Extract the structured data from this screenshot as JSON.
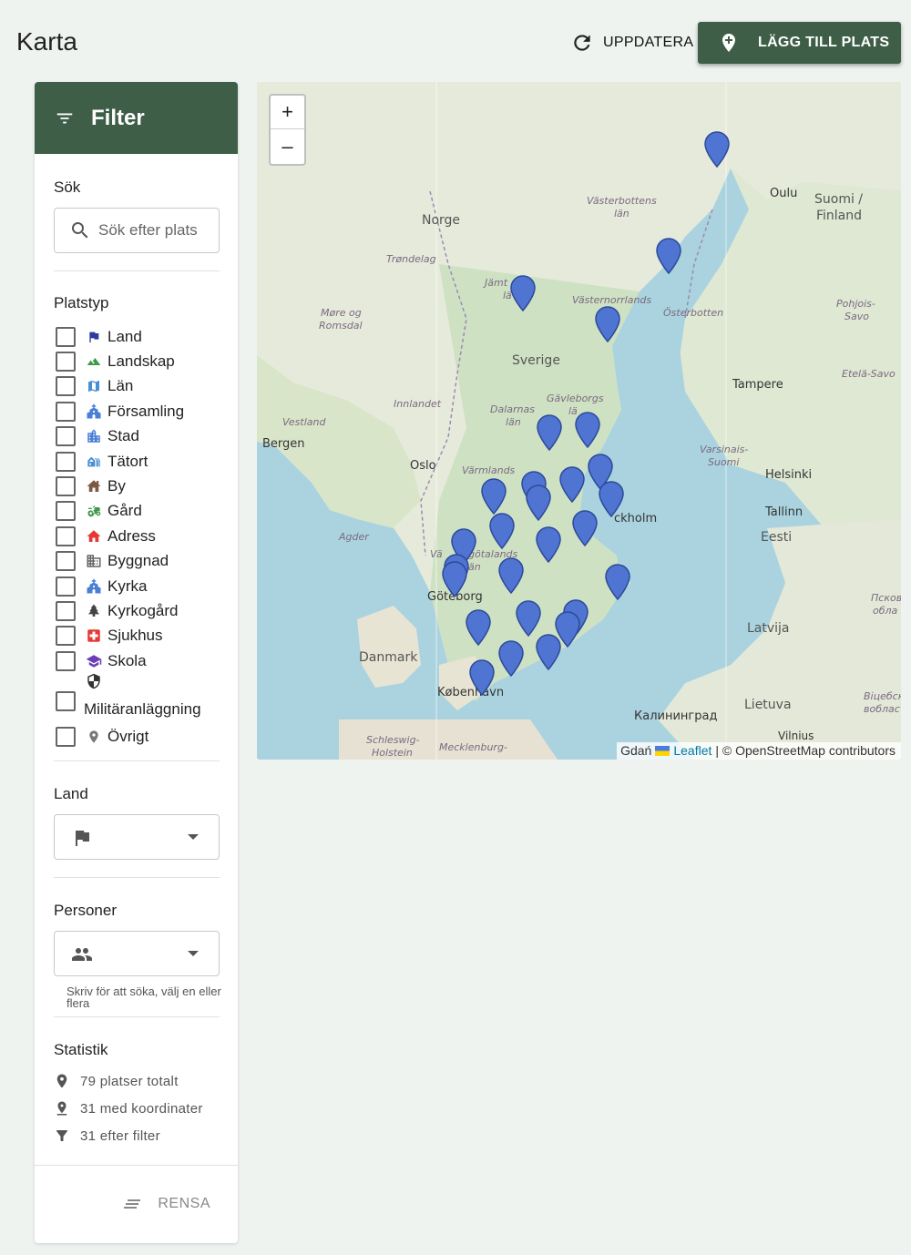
{
  "header": {
    "title": "Karta",
    "refresh_label": "UPPDATERA",
    "add_label": "LÄGG TILL PLATS"
  },
  "sidebar": {
    "filter_title": "Filter",
    "search_label": "Sök",
    "search_placeholder": "Sök efter plats",
    "type_label": "Platstyp",
    "types": [
      {
        "label": "Land",
        "icon": "flag-icon",
        "color": "#2d3a9e"
      },
      {
        "label": "Landskap",
        "icon": "terrain-icon",
        "color": "#3f9a49"
      },
      {
        "label": "Län",
        "icon": "map-icon",
        "color": "#4a8fd6"
      },
      {
        "label": "Församling",
        "icon": "church-icon",
        "color": "#4a7fd6"
      },
      {
        "label": "Stad",
        "icon": "city-icon",
        "color": "#4a7fd6"
      },
      {
        "label": "Tätort",
        "icon": "holiday-village-icon",
        "color": "#4a8fd6"
      },
      {
        "label": "By",
        "icon": "house-icon",
        "color": "#7b5b46"
      },
      {
        "label": "Gård",
        "icon": "tractor-icon",
        "color": "#3f9a49"
      },
      {
        "label": "Adress",
        "icon": "home-icon",
        "color": "#e53935"
      },
      {
        "label": "Byggnad",
        "icon": "building-icon",
        "color": "#666666"
      },
      {
        "label": "Kyrka",
        "icon": "church-icon",
        "color": "#4a7fd6"
      },
      {
        "label": "Kyrkogård",
        "icon": "tree-icon",
        "color": "#444444"
      },
      {
        "label": "Sjukhus",
        "icon": "hospital-icon",
        "color": "#e53935"
      },
      {
        "label": "Skola",
        "icon": "school-icon",
        "color": "#6a3fb5"
      },
      {
        "label": "Militäranläggning",
        "icon": "shield-icon",
        "color": "#333333"
      },
      {
        "label": "Övrigt",
        "icon": "place-icon",
        "color": "#777777"
      }
    ],
    "country_label": "Land",
    "persons_label": "Personer",
    "persons_hint": "Skriv för att söka, välj en eller flera",
    "stats_label": "Statistik",
    "stats": {
      "total": "79 platser totalt",
      "with_coords": "31 med koordinater",
      "filtered": "31 efter filter"
    },
    "clear_label": "RENSA"
  },
  "map": {
    "zoom_in": "+",
    "zoom_out": "–",
    "attribution_link": "Leaflet",
    "attribution_text": "| © OpenStreetMap contributors",
    "attribution_prefix": "Gdań",
    "marker_color": "#4f74d1",
    "marker_count": 31,
    "labels": {
      "norge": "Norge",
      "sverige": "Sverige",
      "suomi": "Suomi /",
      "finland": "Finland",
      "eesti": "Eesti",
      "latvija": "Latvija",
      "lietuva": "Lietuva",
      "danmark": "Danmark",
      "bergen": "Bergen",
      "oslo": "Oslo",
      "goteborg": "Göteborg",
      "kobenhavn": "København",
      "helsinki": "Helsinki",
      "tallinn": "Tallinn",
      "tampere": "Tampere",
      "oulu": "Oulu",
      "stockholm": "ckholm",
      "kaliningrad": "Калининград",
      "vilnius": "Vilnius",
      "pskov": "Псков",
      "oblast": "обла",
      "vitebsk": "Віцебск",
      "voblasts": "вобласт",
      "vasterbottens": "Västerbottens",
      "lan_vb": "län",
      "jamtland": "Jämt",
      "la_j": "lä",
      "vasternorrlands": "Västernorrlands",
      "osterbotten": "Österbotten",
      "trondelag": "Trøndelag",
      "more": "Møre og",
      "romsdal": "Romsdal",
      "innlandet": "Innlandet",
      "vestland": "Vestland",
      "dalarnas": "Dalarnas",
      "lan_d": "län",
      "gavleborgs": "Gävleborgs",
      "la_g": "lä",
      "varmlands": "Värmlands",
      "agder": "Agder",
      "varsinais": "Varsinais-",
      "suomi2": "Suomi",
      "pohjois": "Pohjois-",
      "savo": "Savo",
      "etela": "Etelä-Savo",
      "vas": "Vä",
      "gotalands": "götalands",
      "an": "än",
      "schleswig": "Schleswig-",
      "holstein": "Holstein",
      "mecklenburg": "Mecklenburg-"
    }
  }
}
